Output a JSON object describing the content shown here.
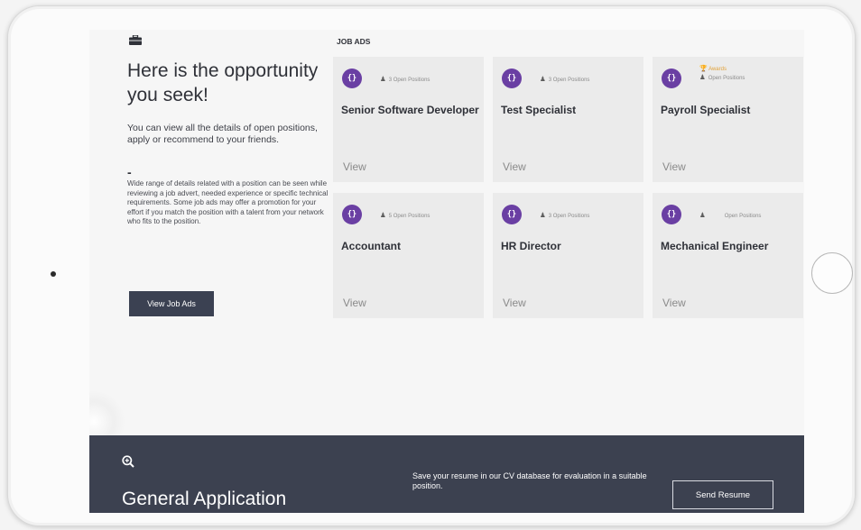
{
  "intro": {
    "icon": "briefcase-icon",
    "headline": "Here is the opportunity you seek!",
    "description": "You can view all the details of open positions, apply or recommend to your friends.",
    "dash": "-",
    "details": "Wide range of details related with a position can be seen while reviewing a job advert, needed experience or specific technical requirements. Some job ads may offer a promotion for your effort if you match the position with a talent from your network who fits to the position.",
    "button_label": "View Job Ads"
  },
  "job_ads": {
    "title": "JOB ADS",
    "view_label": "View",
    "cards": [
      {
        "icon_glyph": "{}",
        "award": "",
        "positions": "3 Open Positions",
        "title": "Senior Software Developer"
      },
      {
        "icon_glyph": "{}",
        "award": "",
        "positions": "3 Open Positions",
        "title": "Test Specialist"
      },
      {
        "icon_glyph": "{}",
        "award": "Awards",
        "positions": "Open Positions",
        "title": "Payroll Specialist"
      },
      {
        "icon_glyph": "{}",
        "award": "",
        "positions": "5 Open Positions",
        "title": "Accountant"
      },
      {
        "icon_glyph": "{}",
        "award": "",
        "positions": "3 Open Positions",
        "title": "HR Director"
      },
      {
        "icon_glyph": "{}",
        "award": "",
        "positions": "Open Positions",
        "title": "Mechanical Engineer"
      }
    ]
  },
  "general_application": {
    "icon": "search-plus-icon",
    "title": "General Application",
    "text": "Save your resume in our CV database for evaluation in a suitable position.",
    "button_label": "Send Resume"
  },
  "colors": {
    "accent_purple": "#6a3fa3",
    "dark_navy": "#3c4150",
    "award_gold": "#e1a23a"
  }
}
